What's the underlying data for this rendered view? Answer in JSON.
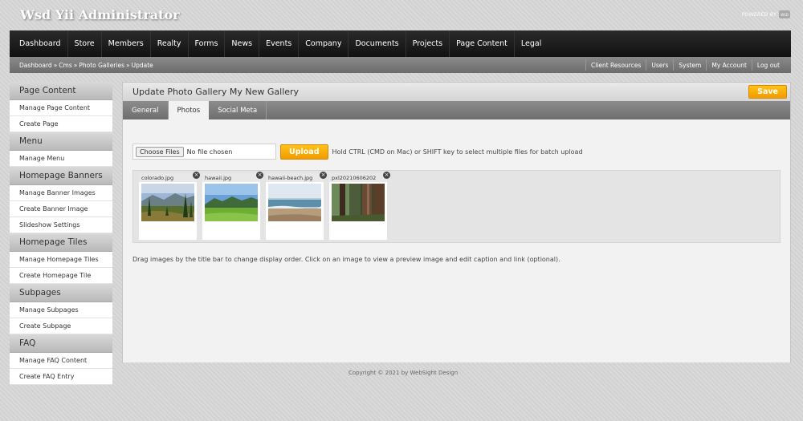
{
  "app": {
    "title": "Wsd Yii Administrator",
    "powered_by": "POWERED BY",
    "powered_logo": "WSD"
  },
  "mainnav": {
    "items": [
      "Dashboard",
      "Store",
      "Members",
      "Realty",
      "Forms",
      "News",
      "Events",
      "Company",
      "Documents",
      "Projects",
      "Page Content",
      "Legal"
    ]
  },
  "breadcrumb": {
    "items": [
      "Dashboard",
      "Cms",
      "Photo Galleries",
      "Update"
    ],
    "separator": "»"
  },
  "utility": {
    "items": [
      "Client Resources",
      "Users",
      "System",
      "My Account",
      "Log out"
    ]
  },
  "sidebar": {
    "sections": [
      {
        "title": "Page Content",
        "items": [
          "Manage Page Content",
          "Create Page"
        ]
      },
      {
        "title": "Menu",
        "items": [
          "Manage Menu"
        ]
      },
      {
        "title": "Homepage Banners",
        "items": [
          "Manage Banner Images",
          "Create Banner Image",
          "Slideshow Settings"
        ]
      },
      {
        "title": "Homepage Tiles",
        "items": [
          "Manage Homepage Tiles",
          "Create Homepage Tile"
        ]
      },
      {
        "title": "Subpages",
        "items": [
          "Manage Subpages",
          "Create Subpage"
        ]
      },
      {
        "title": "FAQ",
        "items": [
          "Manage FAQ Content",
          "Create FAQ Entry"
        ]
      }
    ]
  },
  "panel": {
    "title": "Update Photo Gallery My New Gallery",
    "save_label": "Save",
    "tabs": [
      "General",
      "Photos",
      "Social Meta"
    ],
    "active_tab": "Photos"
  },
  "upload": {
    "choose_label": "Choose Files",
    "no_file": "No file chosen",
    "upload_label": "Upload",
    "hint": "Hold CTRL (CMD on Mac) or SHIFT key to select multiple files for batch upload"
  },
  "gallery": {
    "photos": [
      {
        "name": "colorado.jpg",
        "scene": "forest-hills"
      },
      {
        "name": "hawaii.jpg",
        "scene": "green-mountains"
      },
      {
        "name": "hawaii-beach.jpg",
        "scene": "beach"
      },
      {
        "name": "pxl20210606202",
        "scene": "tree-trunks"
      }
    ],
    "help": "Drag images by the title bar to change display order. Click on an image to view a preview image and edit caption and link (optional)."
  },
  "footer": {
    "text": "Copyright © 2021 by WebSight Design"
  },
  "colors": {
    "accent": "#f5a800",
    "nav_bg": "#1a1a1a",
    "subbar_bg": "#7a7a7a"
  }
}
